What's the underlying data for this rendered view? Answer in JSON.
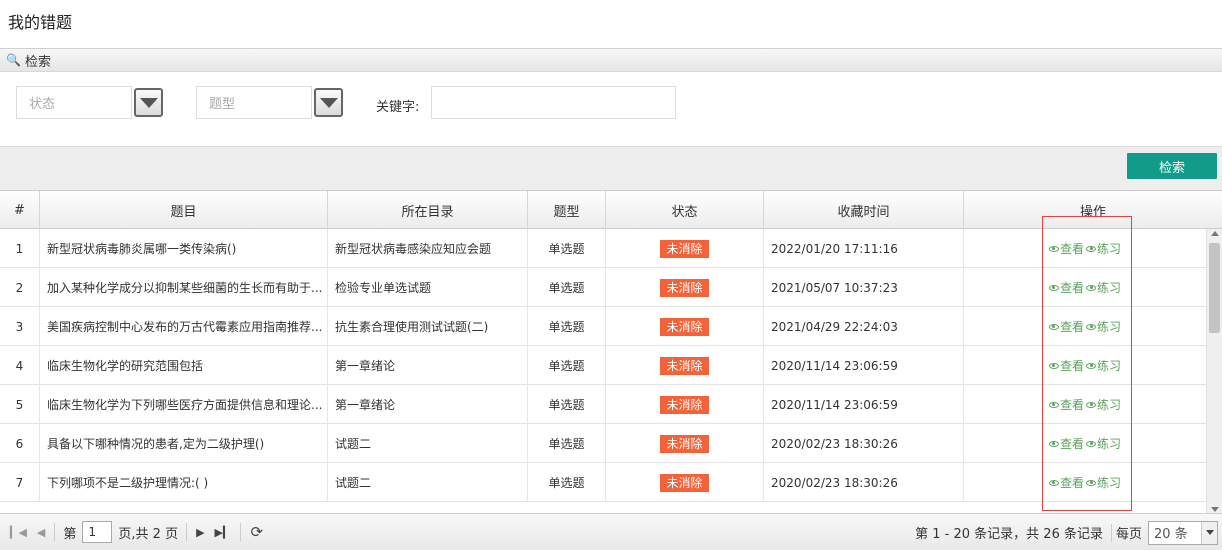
{
  "page": {
    "title": "我的错题"
  },
  "search": {
    "header_icon": "binoculars-icon",
    "header_label": "检索",
    "status_placeholder": "状态",
    "type_placeholder": "题型",
    "keyword_label": "关键字:",
    "keyword_value": "",
    "search_button": "检索"
  },
  "table": {
    "headers": [
      "#",
      "题目",
      "所在目录",
      "题型",
      "状态",
      "收藏时间",
      "操作"
    ],
    "rows": [
      {
        "num": "1",
        "title": "新型冠状病毒肺炎属哪一类传染病()",
        "dir": "新型冠状病毒感染应知应会题",
        "type": "单选题",
        "status": "未消除",
        "time": "2022/01/20 17:11:16"
      },
      {
        "num": "2",
        "title": "加入某种化学成分以抑制某些细菌的生长而有助于...",
        "dir": "检验专业单选试题",
        "type": "单选题",
        "status": "未消除",
        "time": "2021/05/07 10:37:23"
      },
      {
        "num": "3",
        "title": "美国疾病控制中心发布的万古代霉素应用指南推荐...",
        "dir": "抗生素合理使用测试试题(二)",
        "type": "单选题",
        "status": "未消除",
        "time": "2021/04/29 22:24:03"
      },
      {
        "num": "4",
        "title": "临床生物化学的研究范围包括",
        "dir": "第一章绪论",
        "type": "单选题",
        "status": "未消除",
        "time": "2020/11/14 23:06:59"
      },
      {
        "num": "5",
        "title": "临床生物化学为下列哪些医疗方面提供信息和理论...",
        "dir": "第一章绪论",
        "type": "单选题",
        "status": "未消除",
        "time": "2020/11/14 23:06:59"
      },
      {
        "num": "6",
        "title": "具备以下哪种情况的患者,定为二级护理()",
        "dir": "试题二",
        "type": "单选题",
        "status": "未消除",
        "time": "2020/02/23 18:30:26"
      },
      {
        "num": "7",
        "title": "下列哪项不是二级护理情况:( )",
        "dir": "试题二",
        "type": "单选题",
        "status": "未消除",
        "time": "2020/02/23 18:30:26"
      }
    ],
    "op_view": "查看",
    "op_practice": "练习",
    "status_color": "#f4623a",
    "op_color": "#5aa35a"
  },
  "pager": {
    "page_label_pre": "第",
    "page_value": "1",
    "page_label_post": "页,共 2 页",
    "records": "第 1 - 20 条记录，共 26 条记录",
    "per_page_label": "每页",
    "per_page_value": "20 条"
  },
  "colors": {
    "accent": "#119c8a",
    "highlight": "#e84040"
  }
}
